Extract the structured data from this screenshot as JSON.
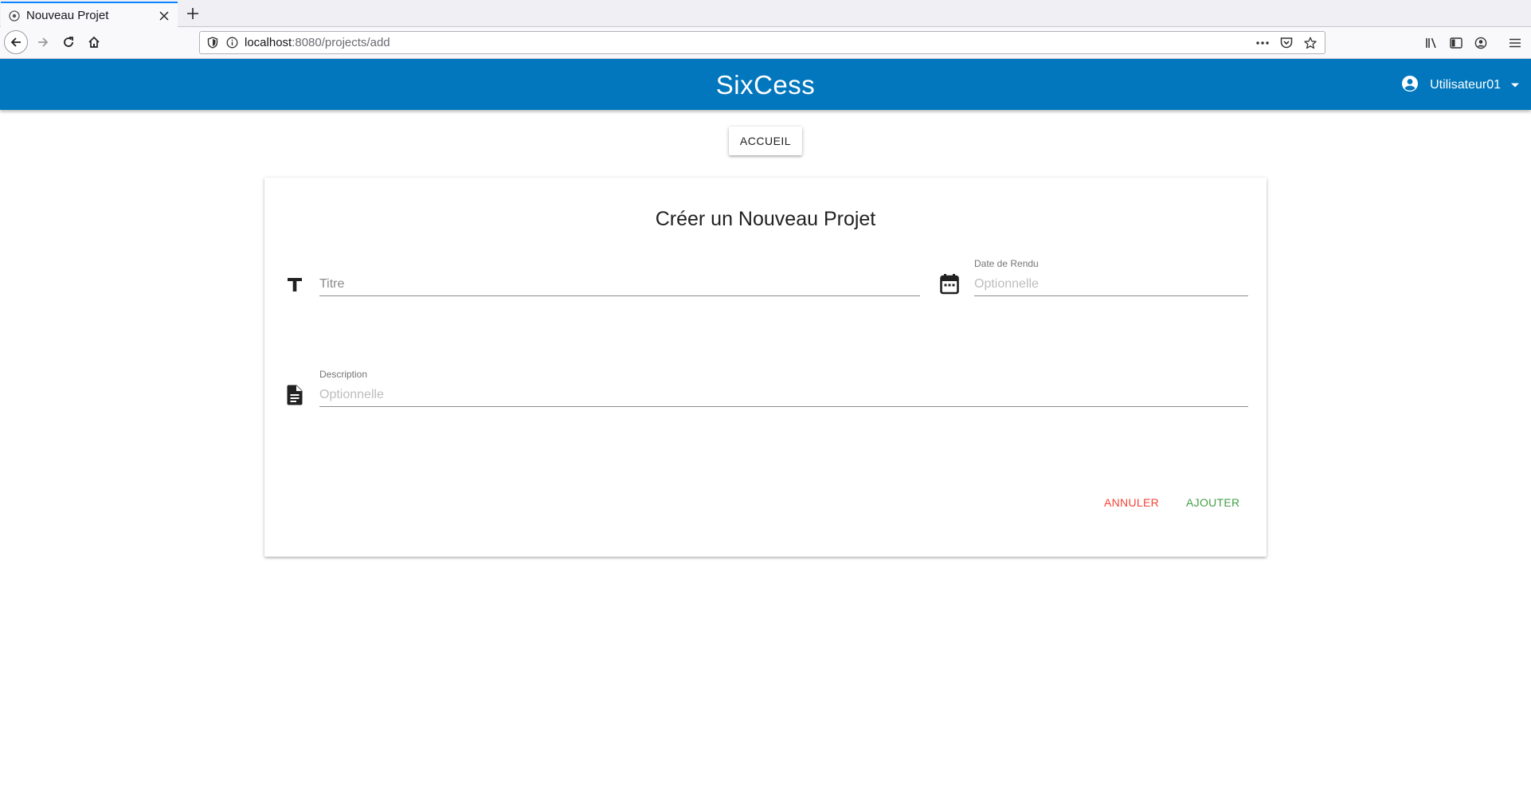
{
  "browser": {
    "tab_title": "Nouveau Projet",
    "url_host": "localhost",
    "url_rest": ":8080/projects/add"
  },
  "app": {
    "title": "SixCess",
    "user_name": "Utilisateur01",
    "home_button": "ACCUEIL"
  },
  "form": {
    "heading": "Créer un Nouveau Projet",
    "title_placeholder": "Titre",
    "due_date_label": "Date de Rendu",
    "due_date_placeholder": "Optionnelle",
    "description_label": "Description",
    "description_placeholder": "Optionnelle",
    "cancel_label": "ANNULER",
    "add_label": "AJOUTER"
  },
  "colors": {
    "appbar": "#0277bd",
    "cancel": "#f44336",
    "add": "#43a047"
  }
}
